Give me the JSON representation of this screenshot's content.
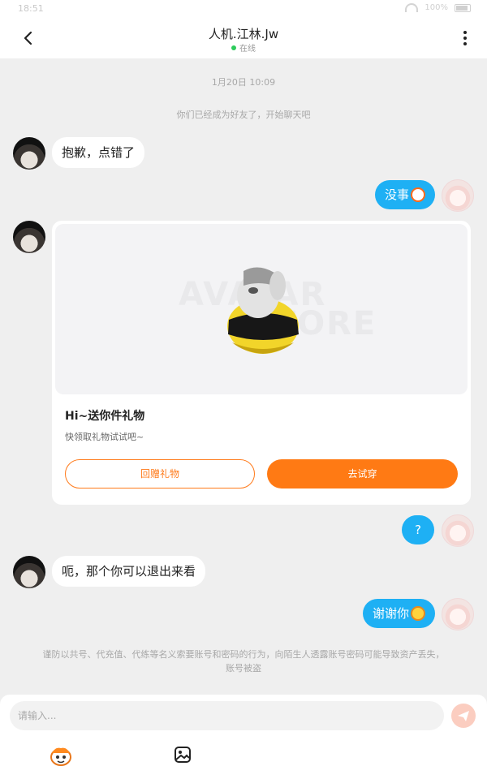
{
  "status_bar": {
    "time": "18:51",
    "battery": "100%"
  },
  "header": {
    "title": "人机.江林.Jw",
    "status": "在线"
  },
  "messages": {
    "timestamp": "1月20日 10:09",
    "system_notice": "你们已经成为好友了，开始聊天吧",
    "m1": "抱歉，点错了",
    "m2": "没事",
    "m4": "?",
    "m5": "呃，那个你可以退出来看",
    "m6": "谢谢你"
  },
  "gift_card": {
    "watermark_line1": "AVATAR",
    "watermark_line2": "STORE",
    "title": "Hi~送你件礼物",
    "subtitle": "快领取礼物试试吧~",
    "return_gift_label": "回赠礼物",
    "try_on_label": "去试穿"
  },
  "security_notice": {
    "line1": "谨防以共号、代充值、代练等名义索要账号和密码的行为，向陌生人透露账号密码可能导致资产丢失，",
    "line2": "账号被盗"
  },
  "input": {
    "placeholder": "请输入..."
  },
  "colors": {
    "accent": "#ff7a14",
    "bubble_self": "#1eb0f4",
    "online": "#2dcb5b"
  },
  "icons": [
    "back-arrow-icon",
    "more-icon",
    "send-icon",
    "emoji-sticker-icon",
    "image-icon"
  ]
}
